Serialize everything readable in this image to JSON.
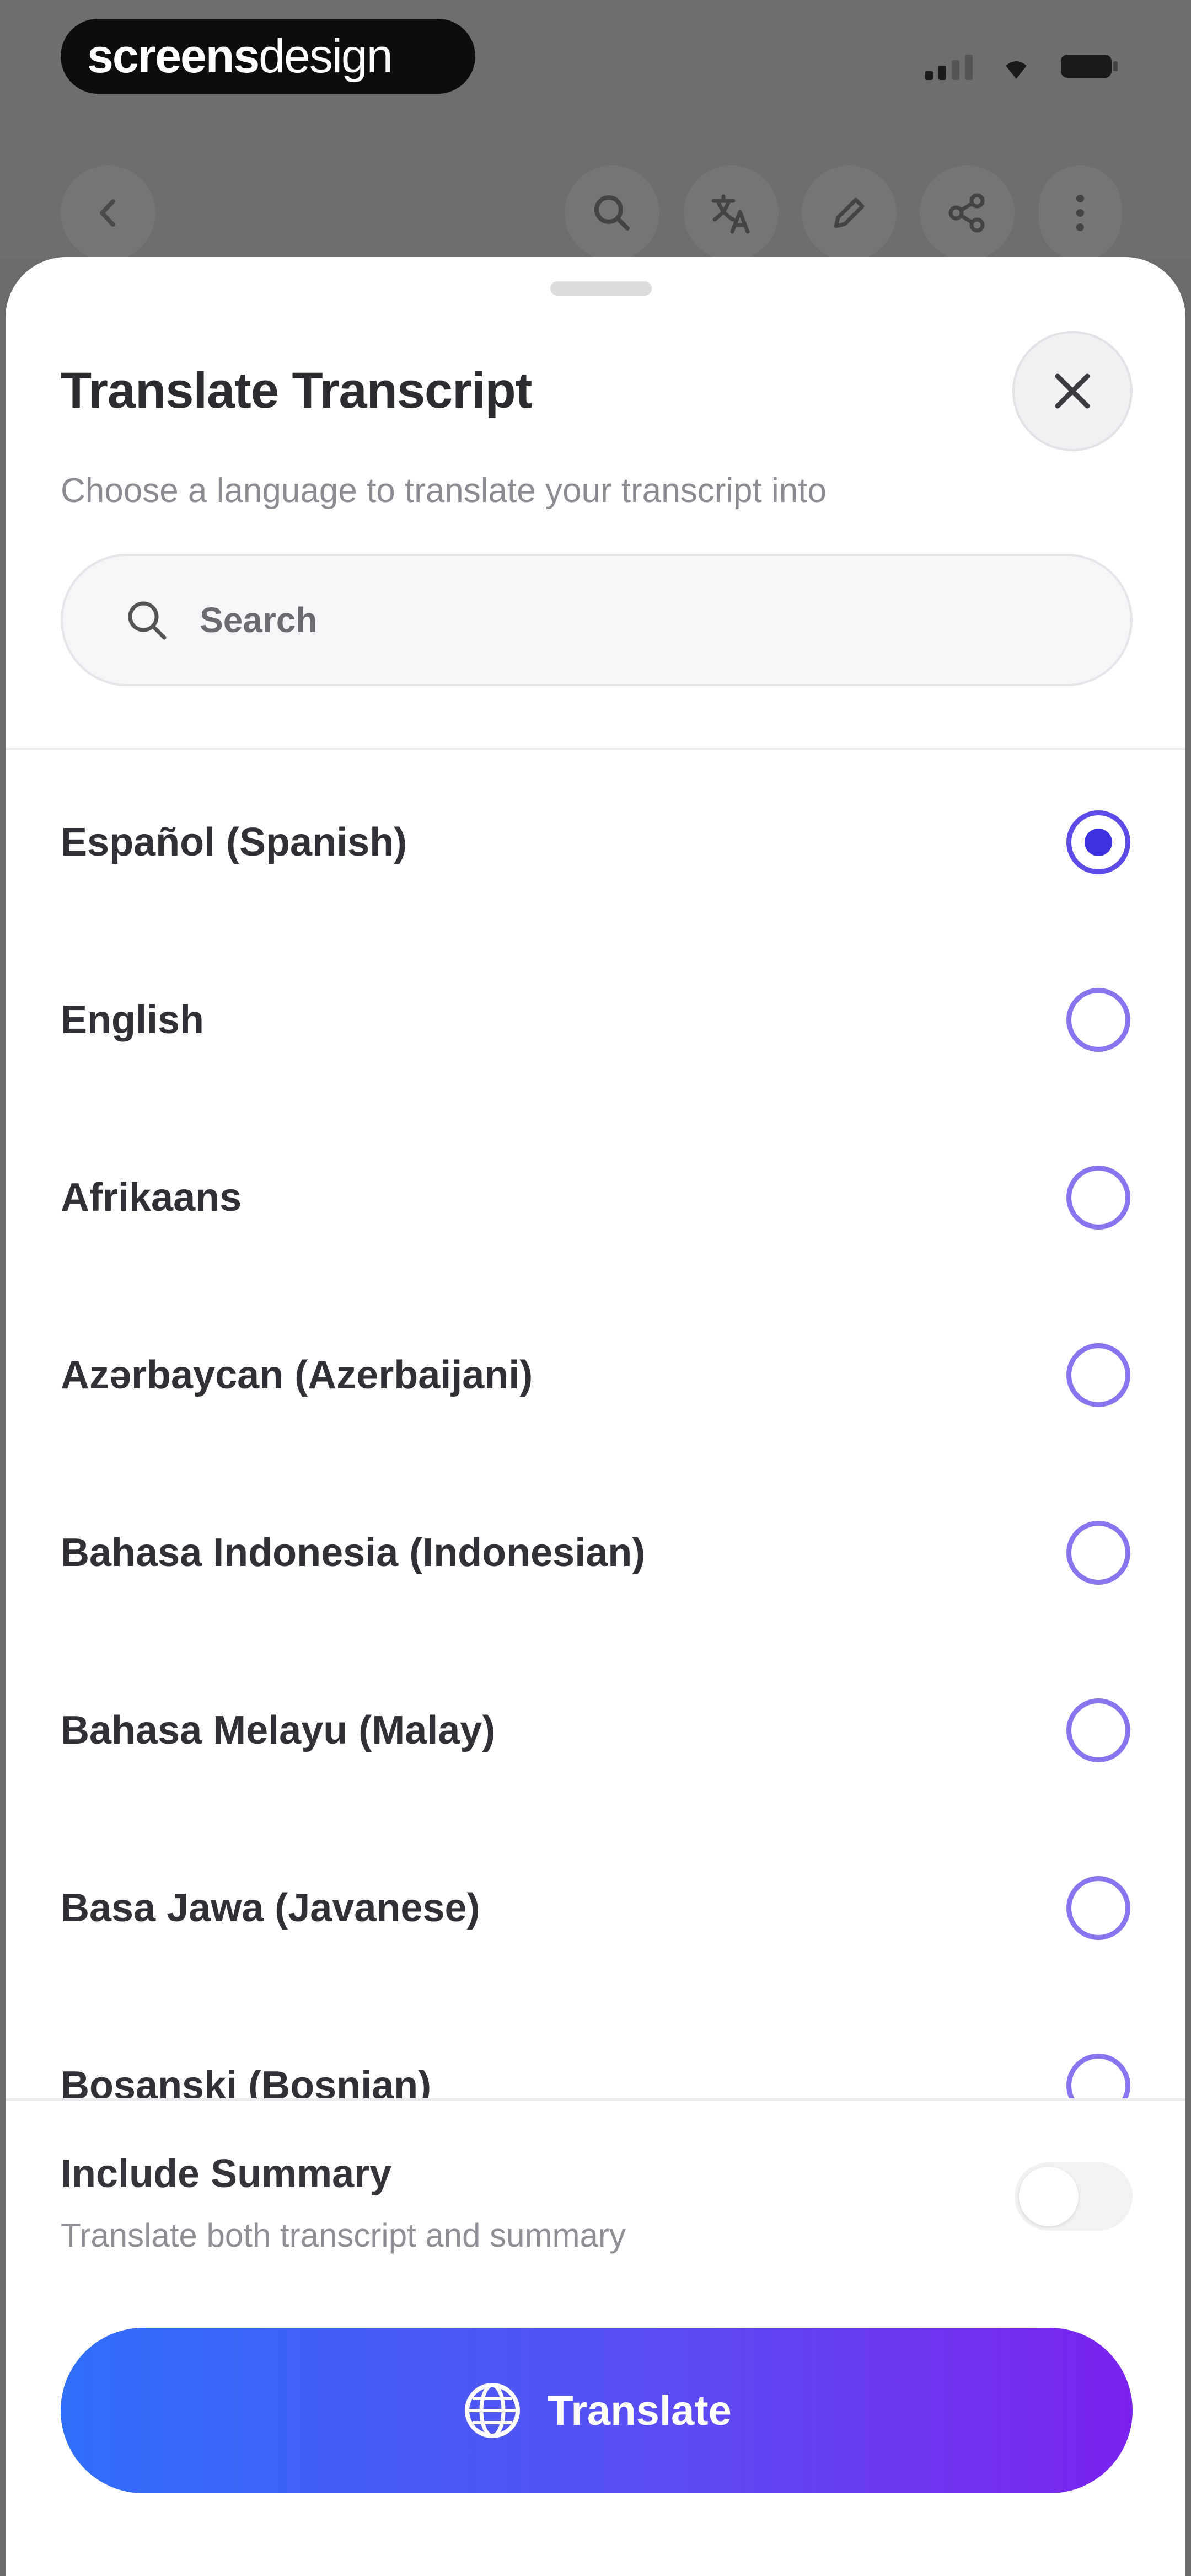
{
  "brand": {
    "part1": "screens",
    "part2": "design"
  },
  "sheet": {
    "title": "Translate Transcript",
    "subtitle": "Choose a language to translate your transcript into",
    "search_placeholder": "Search"
  },
  "languages": [
    {
      "label": "Español (Spanish)",
      "selected": true
    },
    {
      "label": "English",
      "selected": false
    },
    {
      "label": "Afrikaans",
      "selected": false
    },
    {
      "label": "Azərbaycan (Azerbaijani)",
      "selected": false
    },
    {
      "label": "Bahasa Indonesia (Indonesian)",
      "selected": false
    },
    {
      "label": "Bahasa Melayu (Malay)",
      "selected": false
    },
    {
      "label": "Basa Jawa (Javanese)",
      "selected": false
    },
    {
      "label": "Bosanski (Bosnian)",
      "selected": false
    }
  ],
  "summary": {
    "title": "Include Summary",
    "subtitle": "Translate both transcript and summary",
    "enabled": false
  },
  "action": {
    "label": "Translate"
  },
  "colors": {
    "accent": "#3d32e0",
    "radio_ring": "#8a73ee",
    "button_gradient_start": "#2f6ef8",
    "button_gradient_end": "#7c22ef"
  },
  "icons": {
    "toolbar": [
      "back-icon",
      "search-icon",
      "translate-icon",
      "edit-icon",
      "share-icon",
      "more-icon"
    ],
    "close": "close-icon",
    "search": "search-icon",
    "translate": "globe-icon"
  }
}
